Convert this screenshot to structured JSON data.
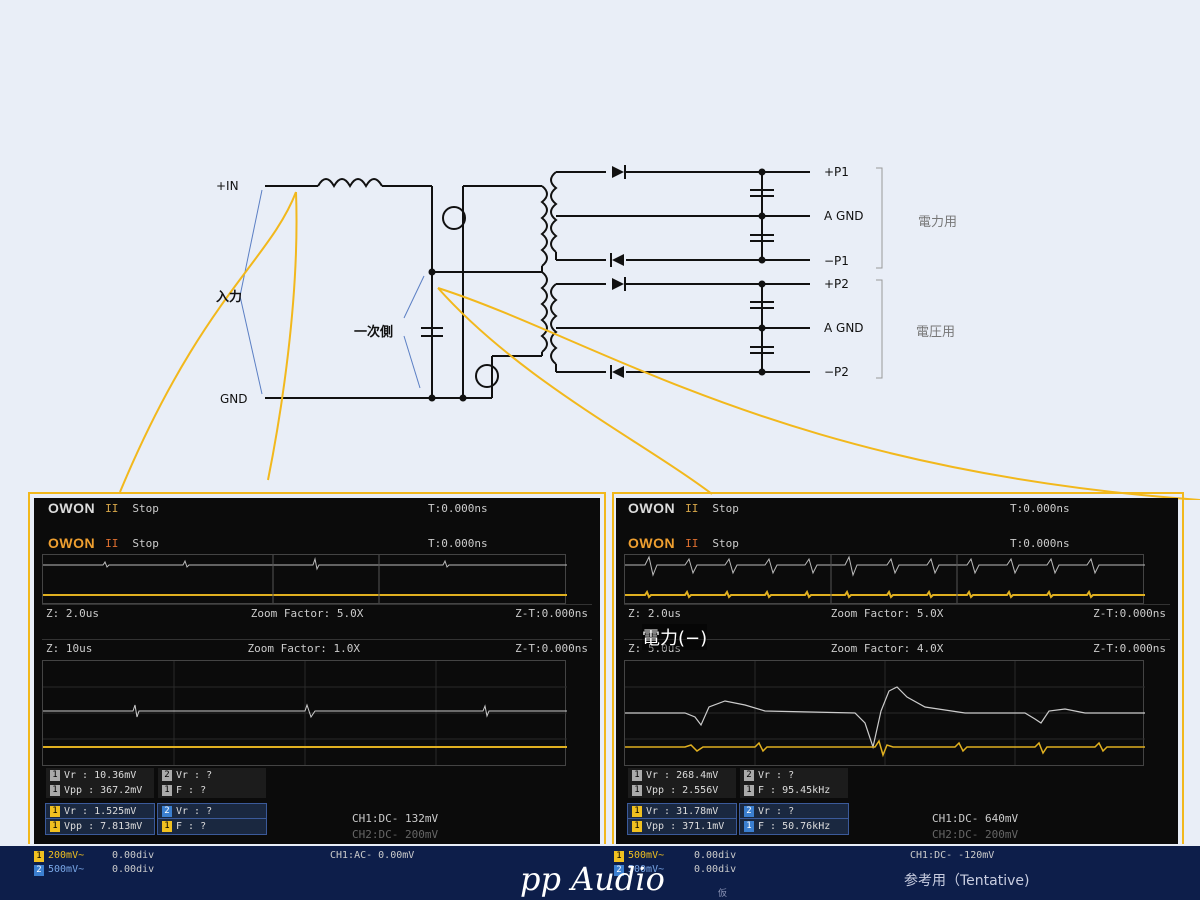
{
  "circuit": {
    "labels": {
      "in_plus": "+IN",
      "input": "入力",
      "gnd": "GND",
      "primary": "一次側",
      "p1_plus": "+P1",
      "agnd1": "A GND",
      "p1_minus": "−P1",
      "p2_plus": "+P2",
      "agnd2": "A GND",
      "p2_minus": "−P2",
      "power_use": "電力用",
      "voltage_use": "電圧用"
    },
    "colors": {
      "highlight": "#f2b81c",
      "arrow": "#5b7fc4",
      "wire": "#111111"
    }
  },
  "scope_left": {
    "logo": "OWON",
    "run": "II",
    "status": "Stop",
    "trigger_time": "T:0.000ns",
    "zoom_main": {
      "z": "Z: 2.0us",
      "factor": "Zoom Factor: 5.0X",
      "zt": "Z-T:0.000ns"
    },
    "zoom_sub": {
      "z": "Z: 10us",
      "factor": "Zoom Factor: 1.0X",
      "zt": "Z-T:0.000ns"
    },
    "meas_top": {
      "vr1": "Vr : 10.36mV",
      "vpp1": "Vpp : 367.2mV",
      "vr2": "Vr :   ?",
      "f2": "F :   ?"
    },
    "meas_bottom": {
      "vr1": "Vr : 1.525mV",
      "vpp1": "Vpp : 7.813mV",
      "vr2": "Vr :   ?",
      "f2": "F :   ?"
    },
    "ch_info_1": "CH1:DC- 132mV",
    "ch_info_2": "CH2:DC- 200mV"
  },
  "scope_right": {
    "logo": "OWON",
    "run": "II",
    "status": "Stop",
    "trigger_time": "T:0.000ns",
    "zoom_main": {
      "z": "Z: 2.0us",
      "factor": "Zoom Factor: 5.0X",
      "zt": "Z-T:0.000ns"
    },
    "zoom_sub": {
      "z": "Z: 5.0us",
      "factor": "Zoom Factor: 4.0X",
      "zt": "Z-T:0.000ns"
    },
    "overlay_label": "電力(−)",
    "meas_top": {
      "vr1": "Vr : 268.4mV",
      "vpp1": "Vpp : 2.556V",
      "vr2": "Vr :   ?",
      "f2": "F : 95.45kHz"
    },
    "meas_bottom": {
      "vr1": "Vr : 31.78mV",
      "vpp1": "Vpp : 371.1mV",
      "vr2": "Vr :   ?",
      "f2": "F : 50.76kHz"
    },
    "ch_info_1": "CH1:DC- 640mV",
    "ch_info_2": "CH2:DC- 200mV"
  },
  "footer": {
    "left_ch1": "200mV~",
    "left_ch1_off": "0.00div",
    "left_ch2": "500mV~",
    "left_ch2_off": "0.00div",
    "left_trig": "CH1:AC- 0.00mV",
    "right_ch1": "500mV~",
    "right_ch1_off": "0.00div",
    "right_ch2": "500mV~",
    "right_ch2_off": "0.00div",
    "right_trig": "CH1:DC- -120mV",
    "brand": "pp Audio",
    "brand_small": "仮",
    "tentative": "参考用（Tentative)"
  }
}
